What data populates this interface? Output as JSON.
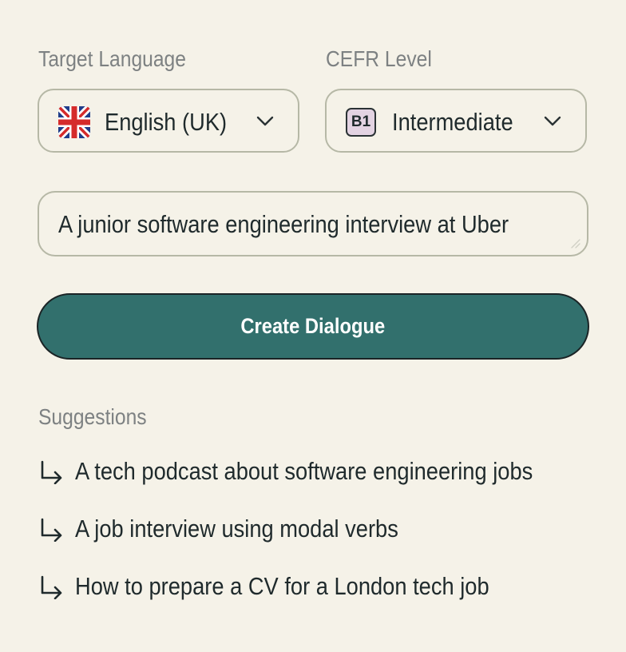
{
  "language": {
    "label": "Target Language",
    "selected": "English (UK)",
    "flag_icon": "uk-flag-icon"
  },
  "cefr": {
    "label": "CEFR Level",
    "badge": "B1",
    "selected": "Intermediate"
  },
  "topic": {
    "value": "A junior software engineering interview at Uber"
  },
  "create_button": {
    "label": "Create Dialogue"
  },
  "suggestions": {
    "heading": "Suggestions",
    "items": [
      {
        "text": "A tech podcast about software engineering jobs"
      },
      {
        "text": "A job interview using modal verbs"
      },
      {
        "text": "How to prepare a CV for a London tech job"
      }
    ]
  },
  "colors": {
    "background": "#f5f2e8",
    "accent": "#32706d",
    "badge_background": "#e3d3e2",
    "border": "#b6b8a6"
  }
}
